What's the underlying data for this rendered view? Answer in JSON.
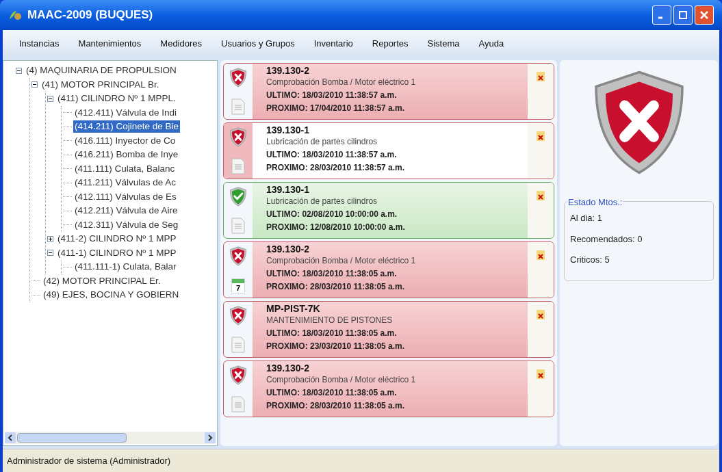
{
  "window": {
    "title": "MAAC-2009 (BUQUES)"
  },
  "menu": [
    "Instancias",
    "Mantenimientos",
    "Medidores",
    "Usuarios y Grupos",
    "Inventario",
    "Reportes",
    "Sistema",
    "Ayuda"
  ],
  "tree": [
    {
      "label": "(4) MAQUINARIA DE PROPULSION",
      "expanded": true,
      "selected": false,
      "children": [
        {
          "label": "(41) MOTOR PRINCIPAL Br.",
          "expanded": true,
          "selected": false,
          "children": [
            {
              "label": "(411) CILINDRO Nº 1 MPPL.",
              "expanded": true,
              "selected": false,
              "children": [
                {
                  "label": "(412.411) Válvula de Indi",
                  "selected": false
                },
                {
                  "label": "(414.211) Cojinete de Bie",
                  "selected": true
                },
                {
                  "label": "(416.111) Inyector de Co",
                  "selected": false
                },
                {
                  "label": "(416.211) Bomba de Inye",
                  "selected": false
                },
                {
                  "label": "(411.111) Culata, Balanc",
                  "selected": false
                },
                {
                  "label": "(411.211) Válvulas de Ac",
                  "selected": false
                },
                {
                  "label": "(412.111) Válvulas de Es",
                  "selected": false
                },
                {
                  "label": "(412.211) Válvula de Aire",
                  "selected": false
                },
                {
                  "label": "(412.311) Válvula de Seg",
                  "selected": false
                }
              ]
            },
            {
              "label": "(411-2) CILINDRO Nº 1 MPP",
              "expanded": false,
              "selected": false
            },
            {
              "label": "(411-1) CILINDRO Nº 1 MPP",
              "expanded": true,
              "selected": false,
              "children": [
                {
                  "label": "(411.111-1) Culata, Balar",
                  "selected": false
                }
              ]
            }
          ]
        },
        {
          "label": "(42) MOTOR PRINCIPAL Er.",
          "selected": false
        },
        {
          "label": "(49) EJES, BOCINA Y GOBIERN",
          "selected": false
        }
      ]
    }
  ],
  "tasks": [
    {
      "kind": "critical",
      "selected": false,
      "attachment": {
        "kind": "document"
      },
      "code": "139.130-2",
      "description": "Comprobación Bomba / Motor eléctrico 1",
      "last": "ULTIMO: 18/03/2010 11:38:57 a.m.",
      "next": "PROXIMO: 17/04/2010 11:38:57 a.m."
    },
    {
      "kind": "critical",
      "selected": true,
      "attachment": {
        "kind": "document"
      },
      "code": "139.130-1",
      "description": "Lubricación de partes cilindros",
      "last": "ULTIMO: 18/03/2010 11:38:57 a.m.",
      "next": "PROXIMO: 28/03/2010 11:38:57 a.m."
    },
    {
      "kind": "ok",
      "selected": false,
      "attachment": {
        "kind": "document"
      },
      "code": "139.130-1",
      "description": "Lubricación de partes cilindros",
      "last": "ULTIMO: 02/08/2010 10:00:00 a.m.",
      "next": "PROXIMO: 12/08/2010 10:00:00 a.m."
    },
    {
      "kind": "critical",
      "selected": false,
      "attachment": {
        "kind": "calendar",
        "day": "7"
      },
      "code": "139.130-2",
      "description": "Comprobación Bomba / Motor eléctrico 1",
      "last": "ULTIMO: 18/03/2010 11:38:05 a.m.",
      "next": "PROXIMO: 28/03/2010 11:38:05 a.m."
    },
    {
      "kind": "critical",
      "selected": false,
      "attachment": {
        "kind": "document"
      },
      "code": "MP-PIST-7K",
      "description": "MANTENIMIENTO DE PISTONES",
      "last": "ULTIMO: 18/03/2010 11:38:05 a.m.",
      "next": "PROXIMO: 23/03/2010 11:38:05 a.m."
    },
    {
      "kind": "critical",
      "selected": false,
      "attachment": {
        "kind": "document"
      },
      "code": "139.130-2",
      "description": "Comprobación Bomba / Motor eléctrico 1",
      "last": "ULTIMO: 18/03/2010 11:38:05 a.m.",
      "next": "PROXIMO: 28/03/2010 11:38:05 a.m."
    }
  ],
  "summary": {
    "kind": "critical",
    "group_title": "Estado Mtos.:",
    "lines": [
      "Al dia: 1",
      "Recomendados: 0",
      "Criticos: 5"
    ]
  },
  "status_bar": "Administrador de sistema (Administrador)"
}
